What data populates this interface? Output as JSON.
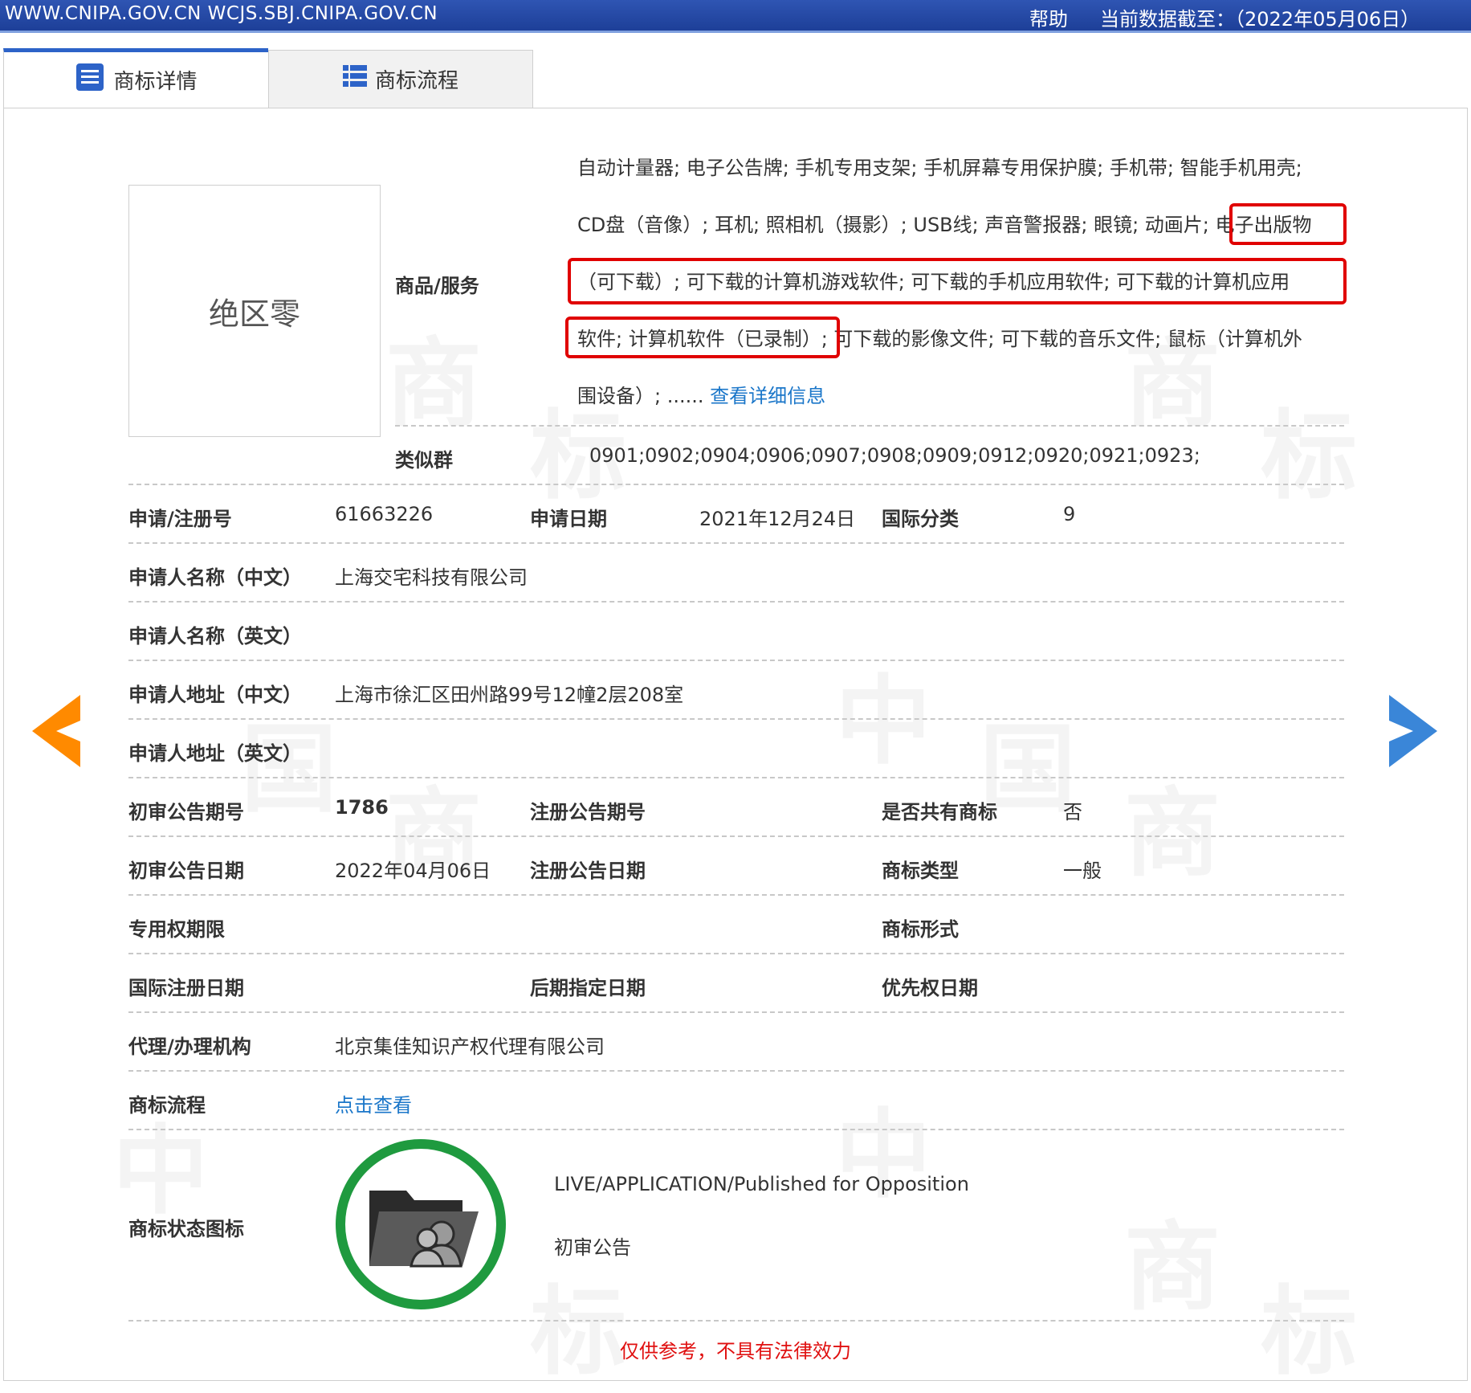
{
  "header": {
    "site": "WWW.CNIPA.GOV.CN WCJS.SBJ.CNIPA.GOV.CN",
    "help": "帮助",
    "data_date": "当前数据截至：（2022年05月06日）"
  },
  "tabs": [
    {
      "label": "商标详情",
      "icon": "document-list-icon",
      "active": true
    },
    {
      "label": "商标流程",
      "icon": "list-icon",
      "active": false
    }
  ],
  "trademark_image_text": "绝区零",
  "goods": {
    "label": "商品/服务",
    "lines": [
      "自动计量器; 电子公告牌; 手机专用支架; 手机屏幕专用保护膜; 手机带; 智能手机用壳;",
      "CD盘（音像）; 耳机; 照相机（摄影）; USB线; 声音警报器; 眼镜; 动画片; 电子出版物",
      "（可下载）; 可下载的计算机游戏软件; 可下载的手机应用软件; 可下载的计算机应用",
      "软件; 计算机软件（已录制）; 可下载的影像文件; 可下载的音乐文件; 鼠标（计算机外",
      "围设备）; ......"
    ],
    "more_link": "查看详细信息"
  },
  "similar_group": {
    "label": "类似群",
    "value": "0901;0902;0904;0906;0907;0908;0909;0912;0920;0921;0923;"
  },
  "fields": {
    "reg_no": {
      "label": "申请/注册号",
      "value": "61663226"
    },
    "app_date": {
      "label": "申请日期",
      "value": "2021年12月24日"
    },
    "intl_class": {
      "label": "国际分类",
      "value": "9"
    },
    "applicant_cn": {
      "label": "申请人名称（中文）",
      "value": "上海交宅科技有限公司"
    },
    "applicant_en": {
      "label": "申请人名称（英文）",
      "value": ""
    },
    "address_cn": {
      "label": "申请人地址（中文）",
      "value": "上海市徐汇区田州路99号12幢2层208室"
    },
    "address_en": {
      "label": "申请人地址（英文）",
      "value": ""
    },
    "prelim_issue": {
      "label": "初审公告期号",
      "value": "1786"
    },
    "reg_issue": {
      "label": "注册公告期号",
      "value": ""
    },
    "shared": {
      "label": "是否共有商标",
      "value": "否"
    },
    "prelim_date": {
      "label": "初审公告日期",
      "value": "2022年04月06日"
    },
    "reg_date": {
      "label": "注册公告日期",
      "value": ""
    },
    "tm_type": {
      "label": "商标类型",
      "value": "一般"
    },
    "exclusive_period": {
      "label": "专用权期限",
      "value": ""
    },
    "tm_form": {
      "label": "商标形式",
      "value": ""
    },
    "intl_reg_date": {
      "label": "国际注册日期",
      "value": ""
    },
    "later_date": {
      "label": "后期指定日期",
      "value": ""
    },
    "priority_date": {
      "label": "优先权日期",
      "value": ""
    },
    "agent": {
      "label": "代理/办理机构",
      "value": "北京集佳知识产权代理有限公司"
    },
    "process": {
      "label": "商标流程",
      "value": "点击查看"
    },
    "status_icon": {
      "label": "商标状态图标",
      "status_en": "LIVE/APPLICATION/Published for Opposition",
      "status_cn": "初审公告"
    }
  },
  "disclaimer": "仅供参考，不具有法律效力",
  "colors": {
    "header_blue": "#2147a8",
    "link": "#1a76c9",
    "highlight_red": "#e00000",
    "status_green": "#1f9a3f",
    "arrow_left": "#ff8a00",
    "arrow_right": "#3a86d8"
  }
}
